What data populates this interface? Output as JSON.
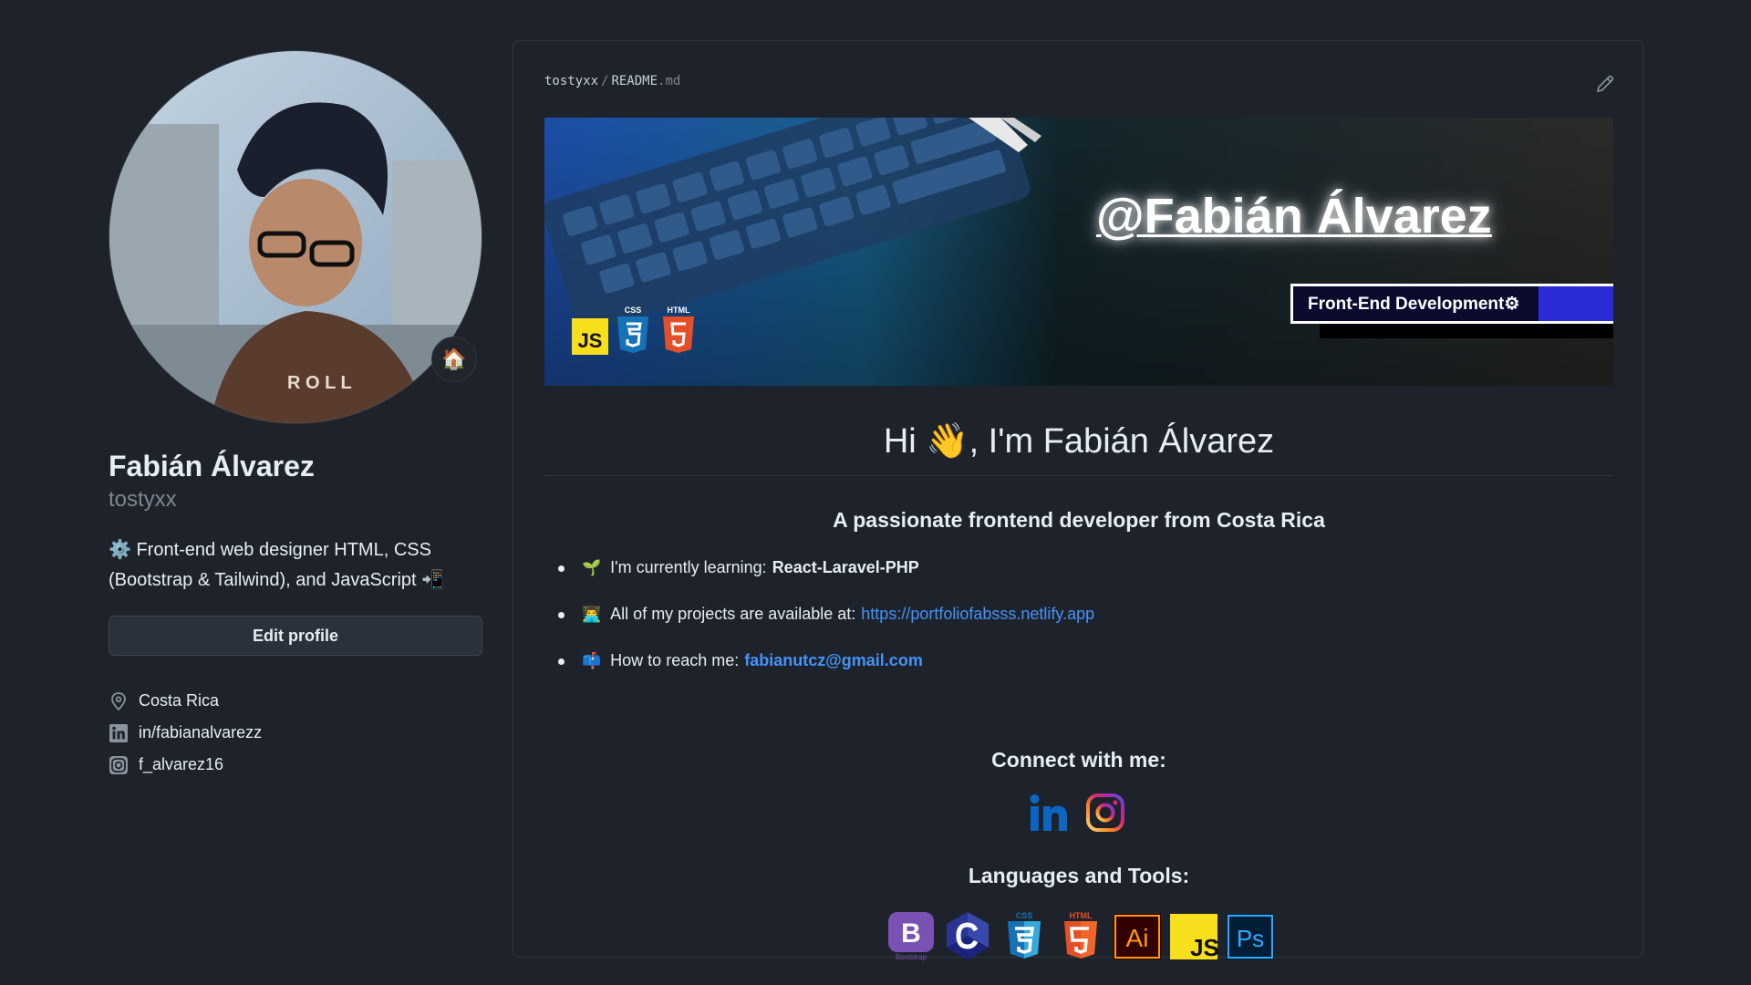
{
  "profile": {
    "fullname": "Fabián Álvarez",
    "username": "tostyxx",
    "status_emoji": "🏠",
    "bio_prefix_emoji": "⚙️",
    "bio": "Front-end web designer HTML, CSS (Bootstrap & Tailwind), and JavaScript",
    "bio_suffix_emoji": "📲",
    "edit_label": "Edit profile",
    "location": "Costa Rica",
    "linkedin": "in/fabianalvarezz",
    "instagram": "f_alvarez16"
  },
  "readme": {
    "repo": "tostyxx",
    "separator": "/",
    "file": "README",
    "ext": ".md",
    "banner": {
      "name": "@Fabián Álvarez",
      "subtitle": "Front-End Development⚙",
      "badges": [
        "JS",
        "CSS",
        "HTML"
      ]
    },
    "greeting": "Hi 👋, I'm Fabián Álvarez",
    "subtitle": "A passionate frontend developer from Costa Rica",
    "facts": [
      {
        "emoji": "🌱",
        "text": "I'm currently learning:",
        "strong": "React-Laravel-PHP"
      },
      {
        "emoji": "👨‍💻",
        "text": "All of my projects are available at:",
        "link": "https://portfoliofabsss.netlify.app"
      },
      {
        "emoji": "📫",
        "text": "How to reach me:",
        "link": "fabianutcz@gmail.com"
      }
    ],
    "connect_title": "Connect with me:",
    "social_icons": [
      "linkedin-icon",
      "instagram-icon"
    ],
    "tools_title": "Languages and Tools:",
    "tools": [
      "bootstrap-icon",
      "c-icon",
      "css3-icon",
      "html5-icon",
      "illustrator-icon",
      "javascript-icon",
      "photoshop-icon"
    ],
    "tool_labels": {
      "bootstrap": "Bootstrap",
      "css": "CSS",
      "html": "HTML",
      "illustrator": "Ai",
      "javascript": "JS",
      "photoshop": "Ps"
    }
  },
  "colors": {
    "background": "#1e232b",
    "link": "#4493f8",
    "border": "#30363d"
  }
}
